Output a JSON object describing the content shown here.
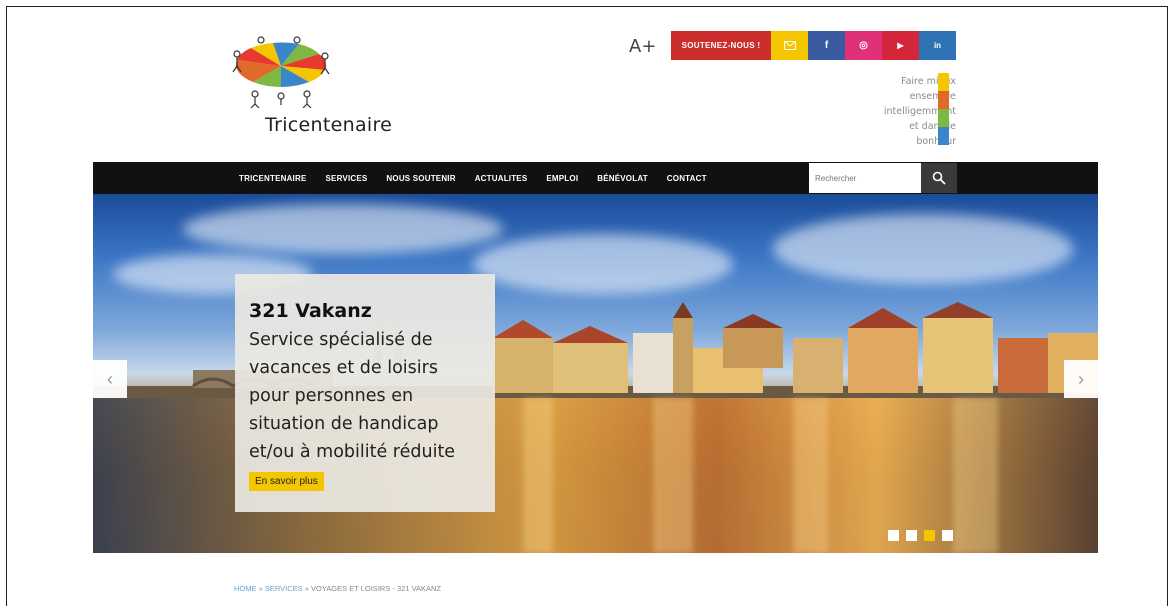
{
  "logo": {
    "name": "Tricentenaire"
  },
  "header": {
    "font_size_label": "A+",
    "support_label": "SOUTENEZ-NOUS !",
    "social": [
      {
        "icon": "newsletter-icon",
        "color": "#f4c600"
      },
      {
        "icon": "facebook-icon",
        "label": "f",
        "color": "#3a5ba0"
      },
      {
        "icon": "instagram-icon",
        "label": "◎",
        "color": "#e0307a"
      },
      {
        "icon": "youtube-icon",
        "label": "▶",
        "color": "#d3263a"
      },
      {
        "icon": "linkedin-icon",
        "label": "in",
        "color": "#2f73b4"
      }
    ],
    "tagline": [
      "Faire mieux",
      "ensemble",
      "intelligemment",
      "et dans le",
      "bonheur"
    ]
  },
  "nav": {
    "items": [
      "TRICENTENAIRE",
      "SERVICES",
      "NOUS SOUTENIR",
      "ACTUALITES",
      "EMPLOI",
      "BÉNÉVOLAT",
      "CONTACT"
    ],
    "search_placeholder": "Rechercher"
  },
  "hero": {
    "title": "321 Vakanz",
    "lines": [
      "Service spécialisé de",
      "vacances et de loisirs",
      "pour personnes en",
      "situation de handicap",
      "et/ou à mobilité réduite"
    ],
    "button_label": "En savoir plus",
    "prev_arrow": "‹",
    "next_arrow": "›",
    "slides": 4,
    "active_slide": 3
  },
  "breadcrumb": {
    "home": "HOME",
    "sep": " » ",
    "services": "SERVICES",
    "current": "VOYAGES ET LOISIRS - 321 VAKANZ"
  },
  "colors": {
    "accent_red": "#cc2e2e",
    "accent_yellow": "#f4c600",
    "tagline_bars": [
      "#f4c600",
      "#e06a2a",
      "#7cb842",
      "#3a86c8"
    ]
  }
}
